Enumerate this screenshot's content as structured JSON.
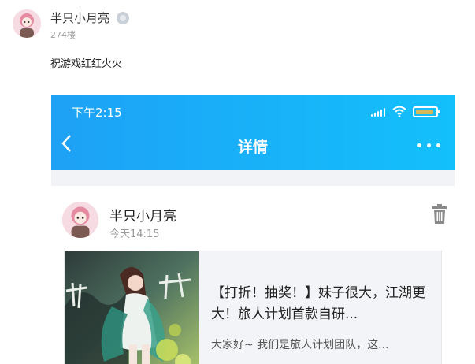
{
  "post": {
    "username": "半只小月亮",
    "floor": "274楼",
    "comment": "祝游戏红红火火"
  },
  "screenshot": {
    "status_time": "下午2:15",
    "nav_title": "详情",
    "card": {
      "username": "半只小月亮",
      "time": "今天14:15",
      "share_title": "【打折！抽奖！】妹子很大，江湖更大！旅人计划首款自研...",
      "share_desc": "大家好~ 我们是旅人计划团队，这..."
    }
  },
  "icons": {
    "badge": "verified-badge-icon",
    "signal": "signal-icon",
    "wifi": "wifi-icon",
    "battery": "battery-icon",
    "back": "chevron-left-icon",
    "more": "more-icon",
    "trash": "trash-icon"
  },
  "colors": {
    "header_gradient_start": "#1ea1f6",
    "header_gradient_end": "#13c0fb",
    "battery_fill": "#d4b85a"
  }
}
